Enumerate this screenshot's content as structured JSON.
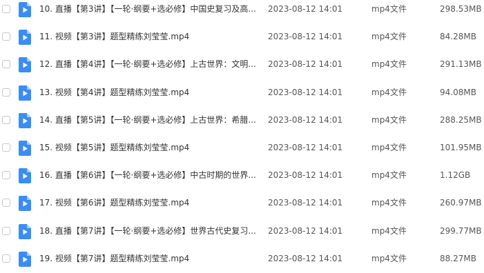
{
  "file_list": {
    "icon": "video-file-icon",
    "icon_color": "#3b8cf5",
    "rows": [
      {
        "name": "10. 直播【第3讲】【一轮·纲要+选必修】中国史复习及高...",
        "date": "2023-08-12 14:01",
        "type": "mp4文件",
        "size": "298.53MB"
      },
      {
        "name": "11. 视频【第3讲】题型精练刘莹莹.mp4",
        "date": "2023-08-12 14:01",
        "type": "mp4文件",
        "size": "84.28MB"
      },
      {
        "name": "12. 直播【第4讲】【一轮·纲要+选必修】上古世界：文明...",
        "date": "2023-08-12 14:01",
        "type": "mp4文件",
        "size": "291.13MB"
      },
      {
        "name": "13. 视频【第4讲】题型精练刘莹莹.mp4",
        "date": "2023-08-12 14:01",
        "type": "mp4文件",
        "size": "94.08MB"
      },
      {
        "name": "14. 直播【第5讲】【一轮·纲要+选必修】上古世界：希腊...",
        "date": "2023-08-12 14:01",
        "type": "mp4文件",
        "size": "288.25MB"
      },
      {
        "name": "15. 视频【第5讲】题型精练刘莹莹.mp4",
        "date": "2023-08-12 14:01",
        "type": "mp4文件",
        "size": "101.95MB"
      },
      {
        "name": "16. 直播【第6讲】【一轮·纲要+选必修】中古时期的世界...",
        "date": "2023-08-12 14:01",
        "type": "mp4文件",
        "size": "1.12GB"
      },
      {
        "name": "17. 视频【第6讲】题型精练刘莹莹.mp4",
        "date": "2023-08-12 14:01",
        "type": "mp4文件",
        "size": "260.97MB"
      },
      {
        "name": "18. 直播【第7讲】【一轮·纲要+选必修】世界古代史复习...",
        "date": "2023-08-12 14:01",
        "type": "mp4文件",
        "size": "299.77MB"
      },
      {
        "name": "19. 视频【第7讲】题型精练刘莹莹.mp4",
        "date": "2023-08-12 14:01",
        "type": "mp4文件",
        "size": "88.27MB"
      }
    ]
  }
}
